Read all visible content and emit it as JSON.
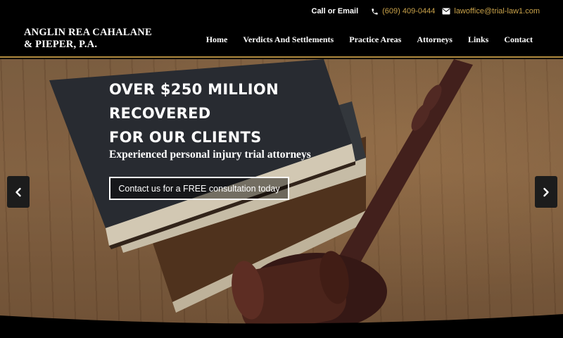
{
  "topbar": {
    "call_label": "Call or Email",
    "phone": "(609) 409-0444",
    "email": "lawoffice@trial-law1.com",
    "phone_icon": "phone-icon",
    "email_icon": "envelope-icon"
  },
  "header": {
    "logo_line1": "ANGLIN REA CAHALANE",
    "logo_line2": "& PIEPER, P.A."
  },
  "nav": {
    "items": [
      {
        "label": "Home"
      },
      {
        "label": "Verdicts And Settlements"
      },
      {
        "label": "Practice Areas"
      },
      {
        "label": "Attorneys"
      },
      {
        "label": "Links"
      },
      {
        "label": "Contact"
      }
    ]
  },
  "hero": {
    "headline_lines": [
      "OVER $250 MILLION",
      "RECOVERED",
      "FOR OUR CLIENTS"
    ],
    "subheadline": "Experienced personal injury trial attorneys",
    "cta_label": "Contact us for a FREE consultation today",
    "prev_icon": "chevron-left-icon",
    "next_icon": "chevron-right-icon"
  },
  "colors": {
    "accent_gold": "#c9a24a",
    "header_bg": "#000000"
  }
}
